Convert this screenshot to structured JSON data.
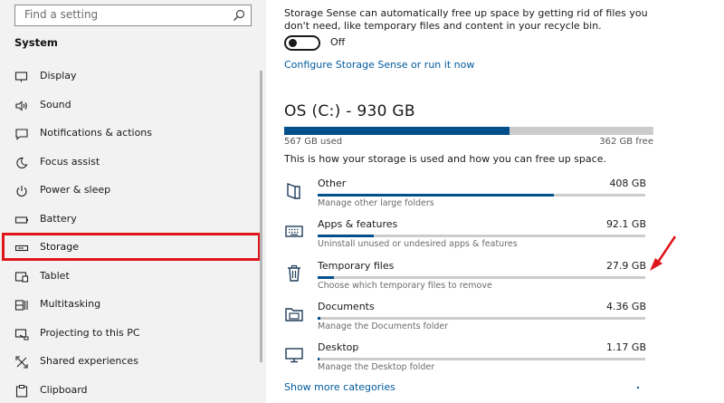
{
  "sidebar": {
    "search_placeholder": "Find a setting",
    "section_title": "System",
    "items": [
      {
        "label": "Display",
        "icon": "monitor-icon"
      },
      {
        "label": "Sound",
        "icon": "speaker-icon"
      },
      {
        "label": "Notifications & actions",
        "icon": "notification-icon"
      },
      {
        "label": "Focus assist",
        "icon": "moon-icon"
      },
      {
        "label": "Power & sleep",
        "icon": "power-icon"
      },
      {
        "label": "Battery",
        "icon": "battery-icon"
      },
      {
        "label": "Storage",
        "icon": "drive-icon",
        "selected": true
      },
      {
        "label": "Tablet",
        "icon": "tablet-icon"
      },
      {
        "label": "Multitasking",
        "icon": "multitasking-icon"
      },
      {
        "label": "Projecting to this PC",
        "icon": "projecting-icon"
      },
      {
        "label": "Shared experiences",
        "icon": "shared-icon"
      },
      {
        "label": "Clipboard",
        "icon": "clipboard-icon"
      }
    ]
  },
  "main": {
    "sense_description": "Storage Sense can automatically free up space by getting rid of files you don't need, like temporary files and content in your recycle bin.",
    "toggle_label": "Off",
    "configure_link": "Configure Storage Sense or run it now",
    "drive_title": "OS (C:) - 930 GB",
    "used_label": "567 GB used",
    "free_label": "362 GB free",
    "used_fraction": 0.61,
    "storage_description": "This is how your storage is used and how you can free up space.",
    "categories": [
      {
        "name": "Other",
        "size": "408 GB",
        "subtitle": "Manage other large folders",
        "icon": "folder-icon",
        "fraction": 0.72
      },
      {
        "name": "Apps & features",
        "size": "92.1 GB",
        "subtitle": "Uninstall unused or undesired apps & features",
        "icon": "keyboard-icon",
        "fraction": 0.17
      },
      {
        "name": "Temporary files",
        "size": "27.9 GB",
        "subtitle": "Choose which temporary files to remove",
        "icon": "trash-icon",
        "fraction": 0.05
      },
      {
        "name": "Documents",
        "size": "4.36 GB",
        "subtitle": "Manage the Documents folder",
        "icon": "documents-icon",
        "fraction": 0.008
      },
      {
        "name": "Desktop",
        "size": "1.17 GB",
        "subtitle": "Manage the Desktop folder",
        "icon": "desktop-icon",
        "fraction": 0.004
      }
    ],
    "more_link": "Show more categories"
  },
  "colors": {
    "accent": "#005a9e",
    "bar_fill": "#00508c",
    "highlight": "#e0151b",
    "sidebar_bg": "#f2f2f2"
  }
}
